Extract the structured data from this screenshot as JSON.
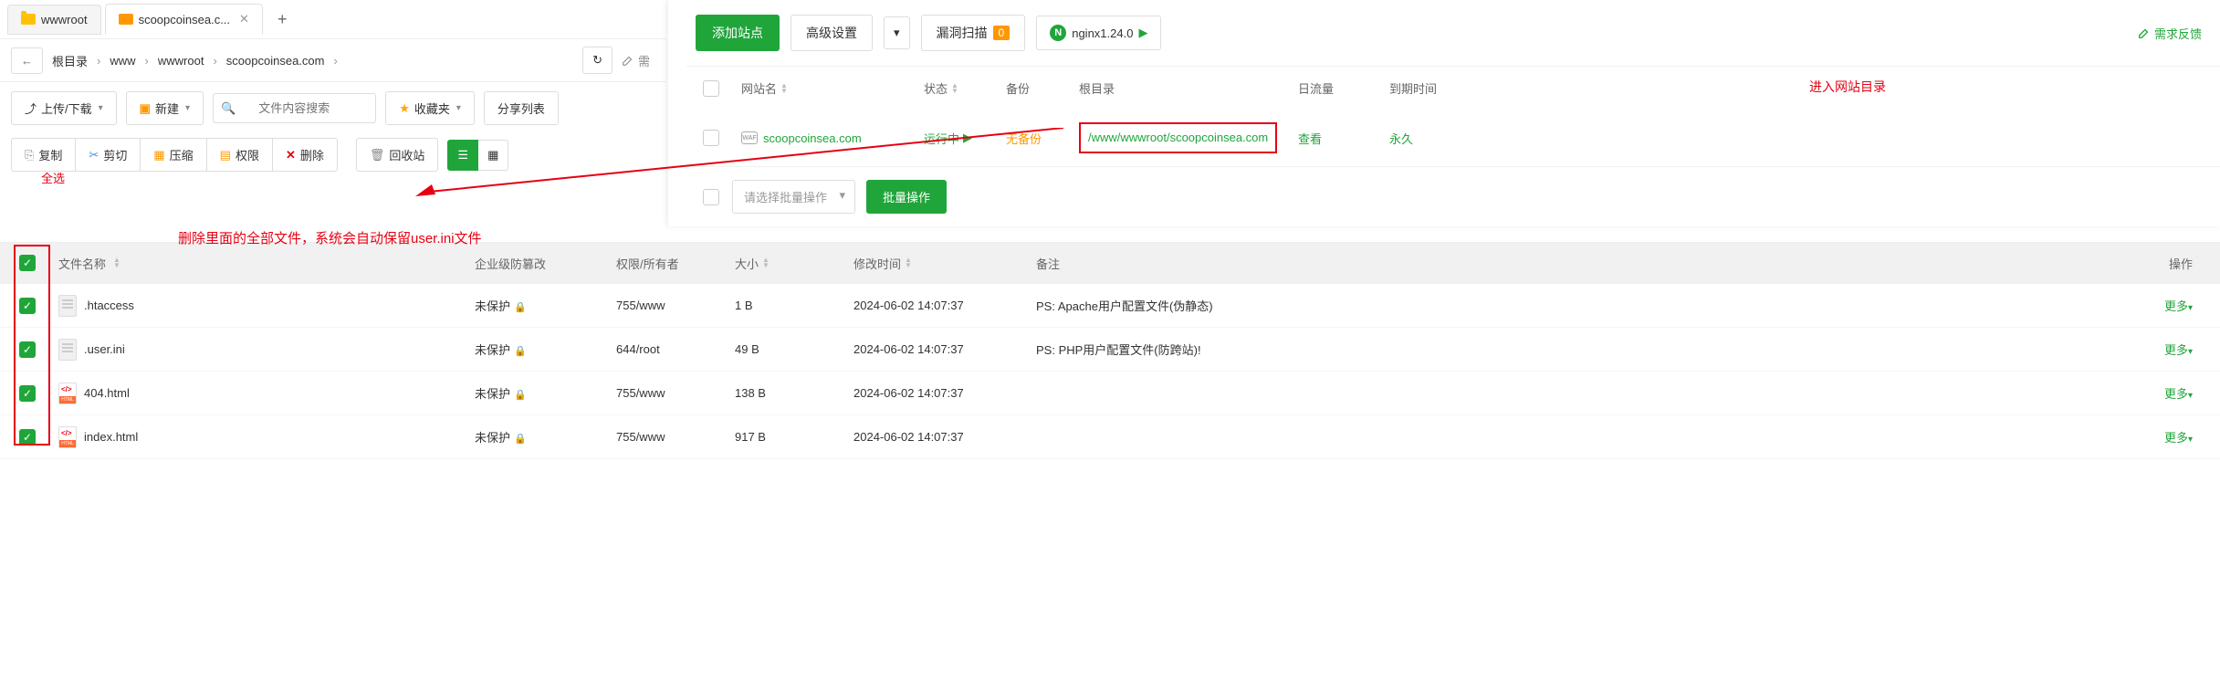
{
  "tabs": [
    {
      "label": "wwwroot",
      "active": false
    },
    {
      "label": "scoopcoinsea.c...",
      "active": true
    }
  ],
  "breadcrumb": {
    "items": [
      "根目录",
      "www",
      "wwwroot",
      "scoopcoinsea.com"
    ],
    "extra": "需"
  },
  "toolbar1": {
    "upload": "上传/下载",
    "new": "新建",
    "search_placeholder": "文件内容搜索",
    "favorites": "收藏夹",
    "share": "分享列表"
  },
  "toolbar2": {
    "copy": "复制",
    "cut": "剪切",
    "compress": "压缩",
    "permission": "权限",
    "delete": "删除",
    "recycle": "回收站"
  },
  "annotations": {
    "select_all": "全选",
    "delete_note": "删除里面的全部文件，系统会自动保留user.ini文件",
    "enter_dir": "进入网站目录"
  },
  "file_table": {
    "headers": {
      "name": "文件名称",
      "protect": "企业级防篡改",
      "perm": "权限/所有者",
      "size": "大小",
      "time": "修改时间",
      "note": "备注",
      "action": "操作"
    },
    "rows": [
      {
        "name": ".htaccess",
        "type": "txt",
        "protect": "未保护",
        "perm": "755/www",
        "size": "1 B",
        "time": "2024-06-02 14:07:37",
        "note": "PS: Apache用户配置文件(伪静态)",
        "more": "更多"
      },
      {
        "name": ".user.ini",
        "type": "txt",
        "protect": "未保护",
        "perm": "644/root",
        "size": "49 B",
        "time": "2024-06-02 14:07:37",
        "note": "PS: PHP用户配置文件(防跨站)!",
        "more": "更多"
      },
      {
        "name": "404.html",
        "type": "html",
        "protect": "未保护",
        "perm": "755/www",
        "size": "138 B",
        "time": "2024-06-02 14:07:37",
        "note": "",
        "more": "更多"
      },
      {
        "name": "index.html",
        "type": "html",
        "protect": "未保护",
        "perm": "755/www",
        "size": "917 B",
        "time": "2024-06-02 14:07:37",
        "note": "",
        "more": "更多"
      }
    ]
  },
  "right_panel": {
    "add_site": "添加站点",
    "advanced": "高级设置",
    "vuln_scan": "漏洞扫描",
    "vuln_count": "0",
    "nginx": "nginx1.24.0",
    "feedback": "需求反馈",
    "headers": {
      "name": "网站名",
      "status": "状态",
      "backup": "备份",
      "root": "根目录",
      "traffic": "日流量",
      "expire": "到期时间"
    },
    "site": {
      "name": "scoopcoinsea.com",
      "status": "运行中",
      "backup": "无备份",
      "root": "/www/wwwroot/scoopcoinsea.com",
      "traffic": "查看",
      "expire": "永久"
    },
    "batch": {
      "placeholder": "请选择批量操作",
      "button": "批量操作"
    }
  }
}
